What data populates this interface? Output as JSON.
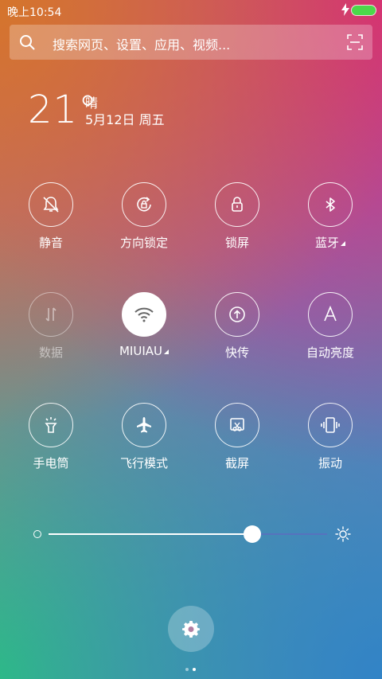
{
  "status_bar": {
    "time": "晚上10:54",
    "bolt_icon": "lightning-icon",
    "battery_color": "#4cd84a"
  },
  "search": {
    "placeholder": "搜索网页、设置、应用、视频...",
    "icon": "search-icon",
    "scan_icon": "scan-icon"
  },
  "weather": {
    "temperature": "21°",
    "condition": "晴",
    "date": "5月12日 周五"
  },
  "toggles": [
    {
      "label": "静音",
      "icon": "bell-muted-icon",
      "state": "off"
    },
    {
      "label": "方向锁定",
      "icon": "rotation-lock-icon",
      "state": "off"
    },
    {
      "label": "锁屏",
      "icon": "lock-icon",
      "state": "off"
    },
    {
      "label": "蓝牙",
      "icon": "bluetooth-icon",
      "state": "off"
    },
    {
      "label": "数据",
      "icon": "data-icon",
      "state": "disabled"
    },
    {
      "label": "MIUIAU",
      "icon": "wifi-icon",
      "state": "on"
    },
    {
      "label": "快传",
      "icon": "upload-icon",
      "state": "off"
    },
    {
      "label": "自动亮度",
      "icon": "auto-brightness-icon",
      "state": "off"
    },
    {
      "label": "手电筒",
      "icon": "flashlight-icon",
      "state": "off"
    },
    {
      "label": "飞行模式",
      "icon": "airplane-icon",
      "state": "off"
    },
    {
      "label": "截屏",
      "icon": "screenshot-icon",
      "state": "off"
    },
    {
      "label": "振动",
      "icon": "vibrate-icon",
      "state": "off"
    }
  ],
  "brightness": {
    "level": 0.73,
    "min_icon": "brightness-low-icon",
    "max_icon": "sun-icon"
  },
  "footer": {
    "settings_icon": "gear-icon",
    "page_count": 2,
    "current_page": 2
  }
}
